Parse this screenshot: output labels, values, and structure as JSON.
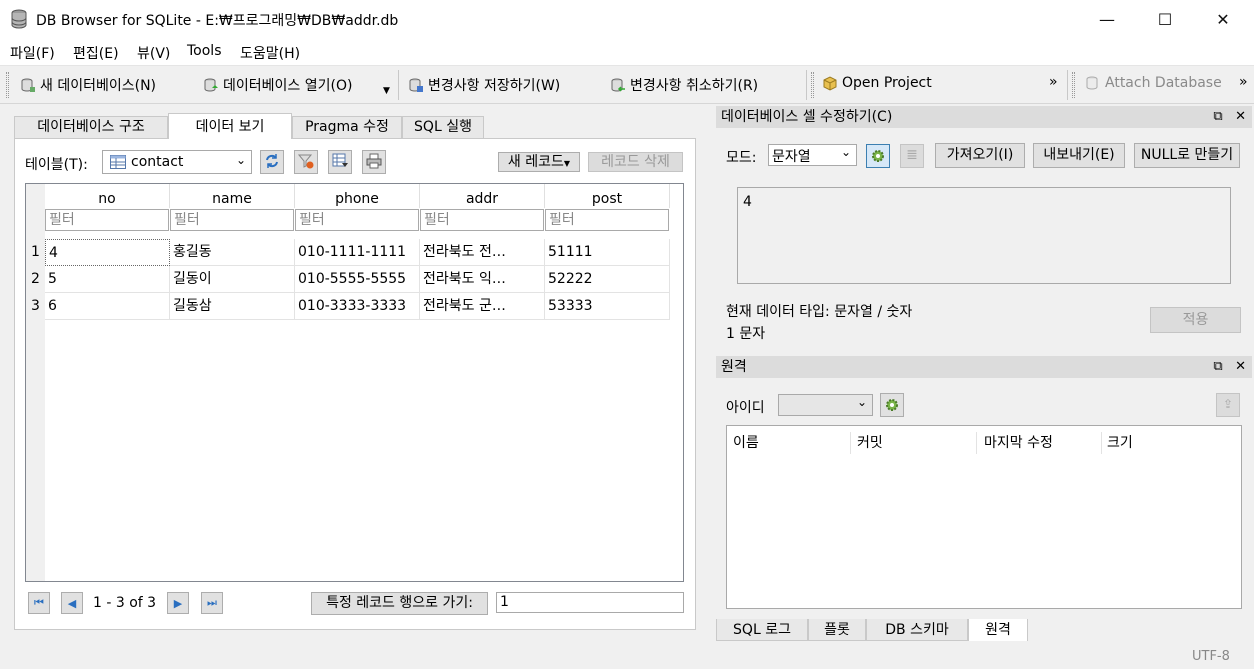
{
  "window": {
    "title": "DB Browser for SQLite - E:₩프로그래밍₩DB₩addr.db",
    "minimize": "—",
    "maximize": "☐",
    "close": "✕"
  },
  "menu": [
    "파일(F)",
    "편집(E)",
    "뷰(V)",
    "Tools",
    "도움말(H)"
  ],
  "toolbar": {
    "new_db": "새 데이터베이스(N)",
    "open_db": "데이터베이스 열기(O)",
    "write_changes": "변경사항 저장하기(W)",
    "revert_changes": "변경사항 취소하기(R)",
    "open_project": "Open Project",
    "more": "»",
    "attach_db": "Attach Database",
    "more2": "»"
  },
  "main_tabs": [
    "데이터베이스 구조",
    "데이터 보기",
    "Pragma 수정",
    "SQL 실행"
  ],
  "browse": {
    "table_label": "테이블(T):",
    "table_value": "contact",
    "new_record": "새 레코드",
    "delete_record": "레코드 삭제",
    "columns": [
      "no",
      "name",
      "phone",
      "addr",
      "post"
    ],
    "filter_placeholder": "필터",
    "rows": [
      {
        "num": "1",
        "cells": [
          "4",
          "홍길동",
          "010-1111-1111",
          "전라북도 전…",
          "51111"
        ]
      },
      {
        "num": "2",
        "cells": [
          "5",
          "길동이",
          "010-5555-5555",
          "전라북도 익…",
          "52222"
        ]
      },
      {
        "num": "3",
        "cells": [
          "6",
          "길동삼",
          "010-3333-3333",
          "전라북도 군…",
          "53333"
        ]
      }
    ],
    "page_info": "1 - 3 of 3",
    "goto_label": "특정 레코드 행으로 가기:",
    "goto_value": "1"
  },
  "edit_cell": {
    "title": "데이터베이스 셀 수정하기(C)",
    "mode_label": "모드:",
    "mode_value": "문자열",
    "import": "가져오기(I)",
    "export": "내보내기(E)",
    "set_null": "NULL로 만들기",
    "value": "4",
    "type_info": "현재 데이터 타입: 문자열 / 숫자",
    "size_info": "1 문자",
    "apply": "적용"
  },
  "remote": {
    "title": "원격",
    "id_label": "아이디",
    "columns": [
      "이름",
      "커밋",
      "마지막 수정",
      "크기"
    ]
  },
  "bottom_tabs": [
    "SQL 로그",
    "플롯",
    "DB 스키마",
    "원격"
  ],
  "status": {
    "encoding": "UTF-8"
  }
}
